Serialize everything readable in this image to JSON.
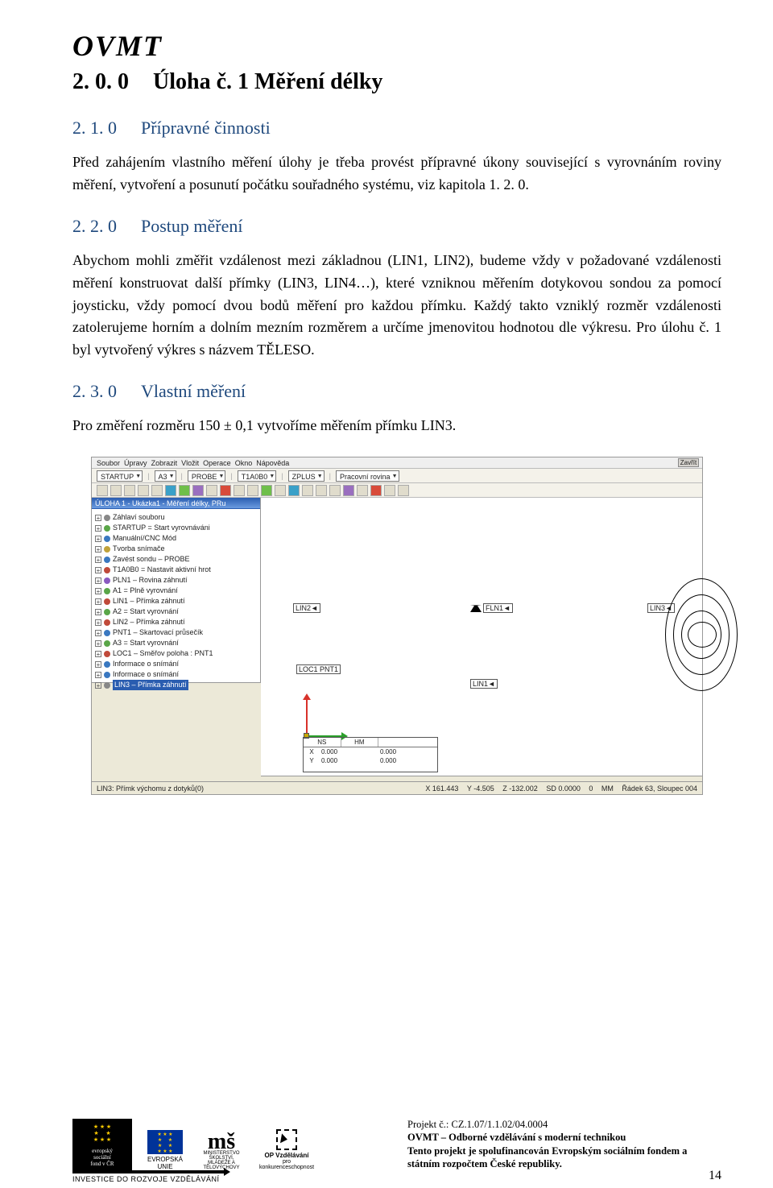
{
  "header": {
    "logo": "OVMT"
  },
  "h1": {
    "index": "2. 0. 0",
    "title": "Úloha č. 1 Měření délky"
  },
  "h2a": {
    "index": "2. 1. 0",
    "title": "Přípravné činnosti"
  },
  "p1": "Před zahájením vlastního měření úlohy je třeba provést přípravné úkony související s vyrovnáním roviny měření, vytvoření a posunutí počátku souřadného systému, viz kapitola 1. 2. 0.",
  "h2b": {
    "index": "2. 2. 0",
    "title": "Postup měření"
  },
  "p2": "Abychom mohli změřit vzdálenost mezi základnou (LIN1, LIN2), budeme vždy v požadované vzdálenosti měření konstruovat další přímky (LIN3, LIN4…), které vzniknou měřením dotykovou sondou za pomocí joysticku, vždy pomocí dvou bodů měření pro každou přímku. Každý takto vzniklý rozměr vzdálenosti zatolerujeme horním a dolním mezním rozměrem a určíme jmenovitou hodnotou dle výkresu. Pro úlohu č. 1 byl vytvořený výkres s názvem TĚLESO.",
  "h2c": {
    "index": "2. 3. 0",
    "title": "Vlastní měření"
  },
  "p3": "Pro změření rozměru 150 ± 0,1 vytvoříme měřením přímku LIN3.",
  "app": {
    "menu": {
      "items": [
        "Soubor",
        "Úpravy",
        "Zobrazit",
        "Vložit",
        "Operace",
        "Okno",
        "Nápověda"
      ],
      "close": "Zavřít"
    },
    "tb1": {
      "s1": "STARTUP",
      "s2": "A3",
      "s3": "PROBE",
      "s4": "T1A0B0",
      "s5": "ZPLUS",
      "s6": "Pracovní rovina"
    },
    "tree_title": "ÚLOHA 1 - Ukázka1 - Měření délky, PRu",
    "tree": [
      {
        "c": "dgr",
        "t": "Záhlaví souboru"
      },
      {
        "c": "dg",
        "t": "STARTUP = Start vyrovnáváni"
      },
      {
        "c": "db",
        "t": "Manuální/CNC Mód"
      },
      {
        "c": "dy",
        "t": "Tvorba snímače"
      },
      {
        "c": "db",
        "t": "Zavést sondu – PROBE"
      },
      {
        "c": "dr",
        "t": "T1A0B0 = Nastavit aktivní hrot"
      },
      {
        "c": "dp",
        "t": "PLN1 – Rovina záhnutí"
      },
      {
        "c": "dg",
        "t": "A1 = Plně vyrovnání"
      },
      {
        "c": "dr",
        "t": "LIN1 – Přímka záhnutí"
      },
      {
        "c": "dg",
        "t": "A2 = Start vyrovnání"
      },
      {
        "c": "dr",
        "t": "LIN2 – Přímka záhnutí"
      },
      {
        "c": "db",
        "t": "PNT1 – Skartovací průsečík"
      },
      {
        "c": "dg",
        "t": "A3 = Start vyrovnání"
      },
      {
        "c": "dr",
        "t": "LOC1 – Směřov poloha : PNT1"
      },
      {
        "c": "db",
        "t": "Informace o snímání"
      },
      {
        "c": "db",
        "t": "Informace o snímání"
      },
      {
        "c": "dgr",
        "t": "LIN3 – Přímka záhnutí",
        "active": true
      }
    ],
    "labels": {
      "lin2": "LIN2◄",
      "fln1": "FLN1◄",
      "lin3": "LIN3◄",
      "lin1": "LIN1◄",
      "loc": "LOC1 PNT1"
    },
    "cbox": {
      "hdr": [
        "NS",
        "HM",
        ""
      ],
      "r1": [
        "X",
        "0.000",
        "0.000"
      ],
      "r2": [
        "Y",
        "0.000",
        "0.000"
      ]
    },
    "status": {
      "left": "LIN3: Přímk výchomu z dotyků(0)",
      "right": [
        "X 161.443",
        "Y -4.505",
        "Z -132.002",
        "SD 0.0000",
        "0",
        "MM",
        "Řádek 63, Sloupec 004"
      ]
    }
  },
  "footer": {
    "esf": {
      "l1": "evropský",
      "l2": "sociální",
      "l3": "fond v ČR"
    },
    "eu": "EVROPSKÁ UNIE",
    "ms": {
      "g": "mš",
      "cap": "MINISTERSTVO ŠKOLSTVÍ,\nMLÁDEŽE A TĚLOVÝCHOVY"
    },
    "op": {
      "t1": "OP Vzdělávání",
      "t2": "pro konkurenceschopnost"
    },
    "inv": "INVESTICE DO ROZVOJE VZDĚLÁVÁNÍ",
    "text": {
      "l1": "Projekt č.: CZ.1.07/1.1.02/04.0004",
      "l2": "OVMT – Odborné vzdělávání s moderní technikou",
      "l3": "Tento projekt je spolufinancován Evropským sociálním fondem a státním rozpočtem České republiky."
    },
    "page": "14"
  }
}
